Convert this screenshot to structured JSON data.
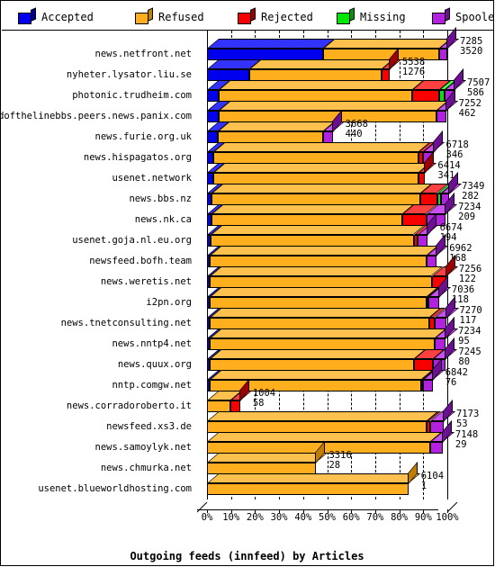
{
  "legend": {
    "items": [
      {
        "label": "Accepted",
        "color": "#0000ee",
        "side": "#000099",
        "icon": "cube-icon"
      },
      {
        "label": "Refused",
        "color": "#ffaf1e",
        "side": "#c07d00",
        "icon": "cube-icon"
      },
      {
        "label": "Rejected",
        "color": "#f80000",
        "side": "#9c0000",
        "icon": "cube-icon"
      },
      {
        "label": "Missing",
        "color": "#00e800",
        "side": "#009900",
        "icon": "cube-icon"
      },
      {
        "label": "Spooled",
        "color": "#b221e0",
        "side": "#6d0f92",
        "icon": "cube-icon"
      }
    ]
  },
  "chart_data": {
    "type": "bar",
    "orientation": "horizontal",
    "stacked": true,
    "percent_axis": true,
    "title": "Outgoing feeds (innfeed) by Articles",
    "xlabel": "",
    "ylabel": "",
    "xlim": [
      0,
      100
    ],
    "xticks": [
      "0%",
      "10%",
      "20%",
      "30%",
      "40%",
      "50%",
      "60%",
      "70%",
      "80%",
      "90%",
      "100%"
    ],
    "xtickvals": [
      0,
      10,
      20,
      30,
      40,
      50,
      60,
      70,
      80,
      90,
      100
    ],
    "grid": true,
    "legend_position": "top",
    "series": [
      {
        "name": "Accepted",
        "color": "#0000ee"
      },
      {
        "name": "Refused",
        "color": "#ffaf1e"
      },
      {
        "name": "Rejected",
        "color": "#f80000"
      },
      {
        "name": "Missing",
        "color": "#00e800"
      },
      {
        "name": "Spooled",
        "color": "#b221e0"
      }
    ],
    "categories": [
      "news.netfront.net",
      "nyheter.lysator.liu.se",
      "photonic.trudheim.com",
      "endofthelinebbs.peers.news.panix.com",
      "news.furie.org.uk",
      "news.hispagatos.org",
      "usenet.network",
      "news.bbs.nz",
      "news.nk.ca",
      "usenet.goja.nl.eu.org",
      "newsfeed.bofh.team",
      "news.weretis.net",
      "i2pn.org",
      "news.tnetconsulting.net",
      "news.nntp4.net",
      "news.quux.org",
      "nntp.comgw.net",
      "news.corradoroberto.it",
      "newsfeed.xs3.de",
      "news.samoylyk.net",
      "news.chmurka.net",
      "usenet.blueworldhosting.com"
    ],
    "rows": [
      {
        "label": "news.netfront.net",
        "total": 7285,
        "second": 3520,
        "total_pct": 100.0,
        "segments": [
          {
            "s": "Accepted",
            "pct": 48.3
          },
          {
            "s": "Refused",
            "pct": 48.4
          },
          {
            "s": "Spooled",
            "pct": 3.3
          }
        ]
      },
      {
        "label": "nyheter.lysator.liu.se",
        "total": 5538,
        "second": 1276,
        "total_pct": 76.0,
        "segments": [
          {
            "s": "Accepted",
            "pct": 17.5
          },
          {
            "s": "Refused",
            "pct": 55.0
          },
          {
            "s": "Rejected",
            "pct": 3.5
          }
        ]
      },
      {
        "label": "photonic.trudheim.com",
        "total": 7507,
        "second": 586,
        "total_pct": 103.0,
        "segments": [
          {
            "s": "Accepted",
            "pct": 5.0
          },
          {
            "s": "Refused",
            "pct": 80.4
          },
          {
            "s": "Rejected",
            "pct": 11.2
          },
          {
            "s": "Missing",
            "pct": 2.2
          },
          {
            "s": "Spooled",
            "pct": 4.2
          }
        ]
      },
      {
        "label": "endofthelinebbs.peers.news.panix.com",
        "total": 7252,
        "second": 462,
        "total_pct": 99.5,
        "segments": [
          {
            "s": "Accepted",
            "pct": 5.0
          },
          {
            "s": "Refused",
            "pct": 90.5
          },
          {
            "s": "Spooled",
            "pct": 4.0
          }
        ]
      },
      {
        "label": "news.furie.org.uk",
        "total": 3668,
        "second": 440,
        "total_pct": 50.3,
        "segments": [
          {
            "s": "Accepted",
            "pct": 4.4
          },
          {
            "s": "Refused",
            "pct": 43.9
          },
          {
            "s": "Spooled",
            "pct": 4.0
          }
        ]
      },
      {
        "label": "news.hispagatos.org",
        "total": 6718,
        "second": 346,
        "total_pct": 92.2,
        "segments": [
          {
            "s": "Accepted",
            "pct": 2.6
          },
          {
            "s": "Refused",
            "pct": 85.5
          },
          {
            "s": "Rejected",
            "pct": 1.9
          },
          {
            "s": "Spooled",
            "pct": 4.2
          }
        ]
      },
      {
        "label": "usenet.network",
        "total": 6414,
        "second": 341,
        "total_pct": 88.0,
        "segments": [
          {
            "s": "Accepted",
            "pct": 2.6
          },
          {
            "s": "Refused",
            "pct": 85.4
          },
          {
            "s": "Rejected",
            "pct": 2.8
          }
        ]
      },
      {
        "label": "news.bbs.nz",
        "total": 7349,
        "second": 282,
        "total_pct": 100.8,
        "segments": [
          {
            "s": "Accepted",
            "pct": 2.0
          },
          {
            "s": "Refused",
            "pct": 86.9
          },
          {
            "s": "Rejected",
            "pct": 6.9
          },
          {
            "s": "Missing",
            "pct": 1.4
          },
          {
            "s": "Spooled",
            "pct": 3.6
          }
        ]
      },
      {
        "label": "news.nk.ca",
        "total": 7234,
        "second": 209,
        "total_pct": 99.3,
        "segments": [
          {
            "s": "Accepted",
            "pct": 2.0
          },
          {
            "s": "Refused",
            "pct": 79.4
          },
          {
            "s": "Rejected",
            "pct": 9.9
          },
          {
            "s": "Spooled",
            "pct": 8.0
          }
        ]
      },
      {
        "label": "usenet.goja.nl.eu.org",
        "total": 6674,
        "second": 194,
        "total_pct": 91.6,
        "segments": [
          {
            "s": "Accepted",
            "pct": 1.6
          },
          {
            "s": "Refused",
            "pct": 84.4
          },
          {
            "s": "Rejected",
            "pct": 1.8
          },
          {
            "s": "Spooled",
            "pct": 3.8
          }
        ]
      },
      {
        "label": "newsfeed.bofh.team",
        "total": 6962,
        "second": 168,
        "total_pct": 95.6,
        "segments": [
          {
            "s": "Accepted",
            "pct": 1.2
          },
          {
            "s": "Refused",
            "pct": 90.2
          },
          {
            "s": "Spooled",
            "pct": 4.2
          }
        ]
      },
      {
        "label": "news.weretis.net",
        "total": 7256,
        "second": 122,
        "total_pct": 99.6,
        "segments": [
          {
            "s": "Accepted",
            "pct": 1.2
          },
          {
            "s": "Refused",
            "pct": 92.3
          },
          {
            "s": "Rejected",
            "pct": 6.1
          }
        ]
      },
      {
        "label": "i2pn.org",
        "total": 7036,
        "second": 118,
        "total_pct": 96.6,
        "segments": [
          {
            "s": "Accepted",
            "pct": 1.2
          },
          {
            "s": "Refused",
            "pct": 90.1
          },
          {
            "s": "Rejected",
            "pct": 0.8
          },
          {
            "s": "Spooled",
            "pct": 4.5
          }
        ]
      },
      {
        "label": "news.tnetconsulting.net",
        "total": 7270,
        "second": 117,
        "total_pct": 99.8,
        "segments": [
          {
            "s": "Accepted",
            "pct": 1.2
          },
          {
            "s": "Refused",
            "pct": 91.4
          },
          {
            "s": "Rejected",
            "pct": 2.0
          },
          {
            "s": "Spooled",
            "pct": 5.2
          }
        ]
      },
      {
        "label": "news.nntp4.net",
        "total": 7234,
        "second": 95,
        "total_pct": 99.3,
        "segments": [
          {
            "s": "Accepted",
            "pct": 1.0
          },
          {
            "s": "Refused",
            "pct": 93.6
          },
          {
            "s": "Spooled",
            "pct": 4.7
          }
        ]
      },
      {
        "label": "news.quux.org",
        "total": 7245,
        "second": 80,
        "total_pct": 99.4,
        "segments": [
          {
            "s": "Accepted",
            "pct": 1.0
          },
          {
            "s": "Refused",
            "pct": 85.1
          },
          {
            "s": "Rejected",
            "pct": 8.0
          },
          {
            "s": "Spooled",
            "pct": 5.3
          }
        ]
      },
      {
        "label": "nntp.comgw.net",
        "total": 6842,
        "second": 76,
        "total_pct": 93.9,
        "segments": [
          {
            "s": "Accepted",
            "pct": 1.0
          },
          {
            "s": "Refused",
            "pct": 88.2
          },
          {
            "s": "Rejected",
            "pct": 0.6
          },
          {
            "s": "Spooled",
            "pct": 4.1
          }
        ]
      },
      {
        "label": "news.corradoroberto.it",
        "total": 1004,
        "second": 58,
        "total_pct": 13.8,
        "segments": [
          {
            "s": "Refused",
            "pct": 9.8
          },
          {
            "s": "Rejected",
            "pct": 4.0
          }
        ]
      },
      {
        "label": "newsfeed.xs3.de",
        "total": 7173,
        "second": 53,
        "total_pct": 98.5,
        "segments": [
          {
            "s": "Refused",
            "pct": 91.5
          },
          {
            "s": "Rejected",
            "pct": 1.2
          },
          {
            "s": "Spooled",
            "pct": 5.8
          }
        ]
      },
      {
        "label": "news.samoylyk.net",
        "total": 7148,
        "second": 29,
        "total_pct": 98.1,
        "segments": [
          {
            "s": "Refused",
            "pct": 93.0
          },
          {
            "s": "Spooled",
            "pct": 5.1
          }
        ]
      },
      {
        "label": "news.chmurka.net",
        "total": 3316,
        "second": 28,
        "total_pct": 45.5,
        "segments": [
          {
            "s": "Refused",
            "pct": 45.5
          }
        ]
      },
      {
        "label": "usenet.blueworldhosting.com",
        "total": 6104,
        "second": 1,
        "total_pct": 83.8,
        "segments": [
          {
            "s": "Refused",
            "pct": 83.8
          }
        ]
      }
    ]
  }
}
